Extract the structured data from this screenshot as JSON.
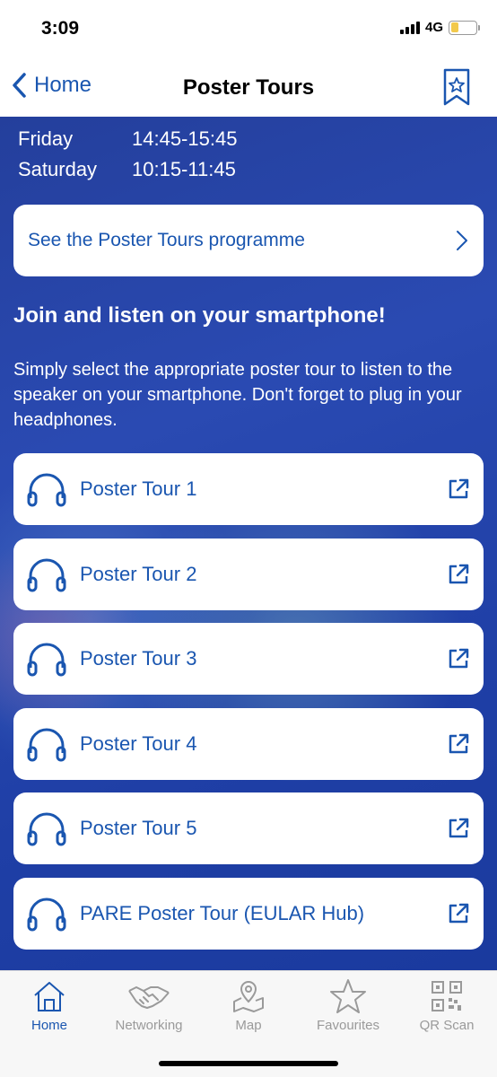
{
  "status": {
    "time": "3:09",
    "network": "4G"
  },
  "nav": {
    "back_label": "Home",
    "title": "Poster Tours"
  },
  "schedule": [
    {
      "day": "Friday",
      "time": "14:45-15:45"
    },
    {
      "day": "Saturday",
      "time": "10:15-11:45"
    }
  ],
  "programme_link": "See the Poster Tours programme",
  "join": {
    "heading": "Join and listen on your smartphone!",
    "description": "Simply select the appropriate poster tour to listen to the speaker on your smartphone. Don't forget to plug in your headphones."
  },
  "tours": [
    {
      "label": "Poster Tour 1"
    },
    {
      "label": "Poster Tour 2"
    },
    {
      "label": "Poster Tour 3"
    },
    {
      "label": "Poster Tour 4"
    },
    {
      "label": "Poster Tour 5"
    },
    {
      "label": "PARE Poster Tour (EULAR Hub)"
    }
  ],
  "tabs": [
    {
      "label": "Home",
      "icon": "home-icon",
      "active": true
    },
    {
      "label": "Networking",
      "icon": "handshake-icon"
    },
    {
      "label": "Map",
      "icon": "map-icon"
    },
    {
      "label": "Favourites",
      "icon": "star-icon"
    },
    {
      "label": "QR Scan",
      "icon": "qr-code-icon"
    }
  ],
  "colors": {
    "accent": "#1a56b0",
    "background": "#2a4ab2",
    "tab_inactive": "#9a9a9a",
    "battery": "#f2c94c"
  }
}
